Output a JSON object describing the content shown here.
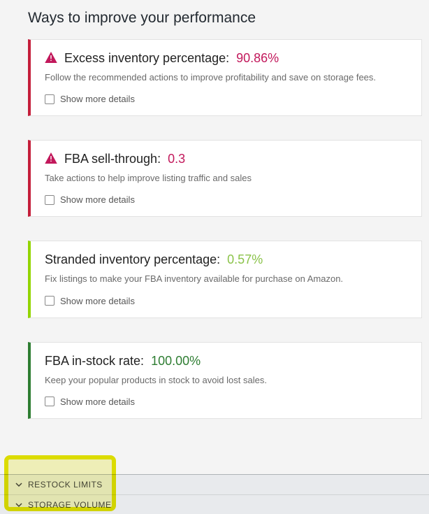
{
  "page_title": "Ways to improve your performance",
  "cards": [
    {
      "severity": "crimson",
      "has_icon": true,
      "metric_name": "Excess inventory percentage:",
      "metric_value": "90.86%",
      "value_class": "crimson-text",
      "desc": "Follow the recommended actions to improve profitability and save on storage fees.",
      "show_more_label": "Show more details"
    },
    {
      "severity": "crimson",
      "has_icon": true,
      "metric_name": "FBA sell-through:",
      "metric_value": "0.3",
      "value_class": "crimson-text",
      "desc": "Take actions to help improve listing traffic and sales",
      "show_more_label": "Show more details"
    },
    {
      "severity": "lime",
      "has_icon": false,
      "metric_name": "Stranded inventory percentage:",
      "metric_value": "0.57%",
      "value_class": "lime-text",
      "desc": "Fix listings to make your FBA inventory available for purchase on Amazon.",
      "show_more_label": "Show more details"
    },
    {
      "severity": "green",
      "has_icon": false,
      "metric_name": "FBA in-stock rate:",
      "metric_value": "100.00%",
      "value_class": "green-text",
      "desc": "Keep your popular products in stock to avoid lost sales.",
      "show_more_label": "Show more details"
    }
  ],
  "bottom": {
    "rows": [
      {
        "label": "RESTOCK LIMITS"
      },
      {
        "label": "STORAGE VOLUME"
      }
    ]
  }
}
